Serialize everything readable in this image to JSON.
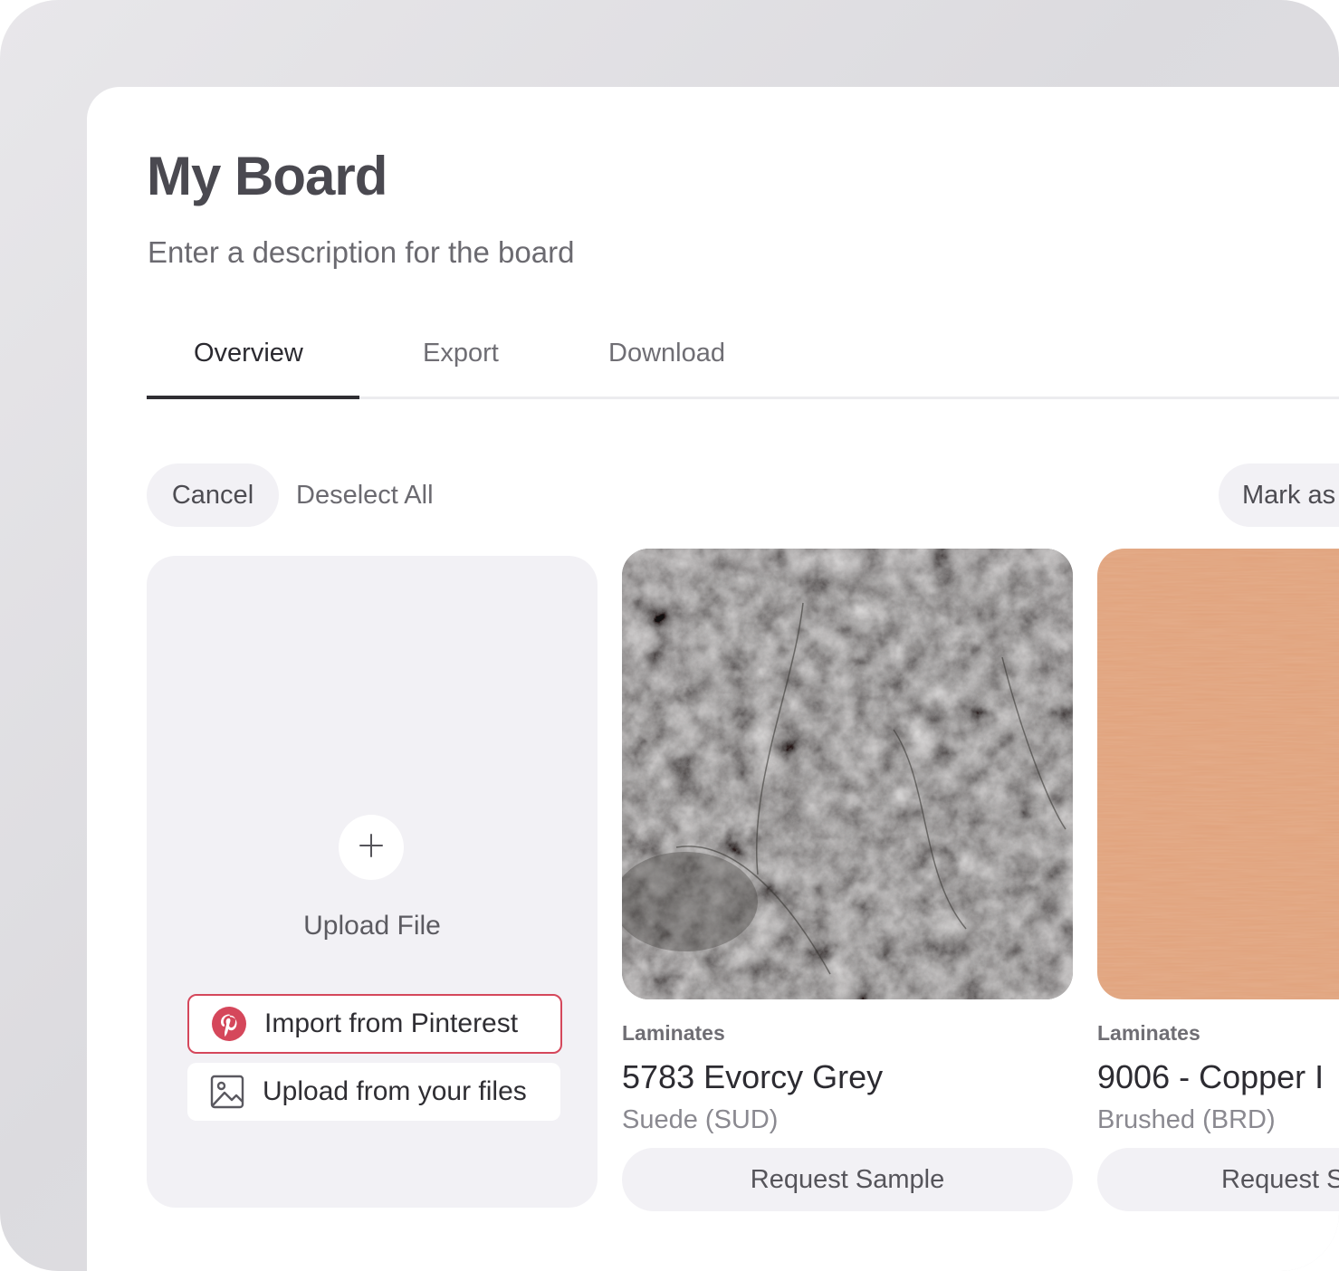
{
  "board": {
    "title": "My Board",
    "description": "Enter a description for the board"
  },
  "tabs": [
    {
      "label": "Overview",
      "active": true
    },
    {
      "label": "Export",
      "active": false
    },
    {
      "label": "Download",
      "active": false
    }
  ],
  "toolbar": {
    "cancel_label": "Cancel",
    "deselect_label": "Deselect All",
    "mark_label": "Mark as"
  },
  "upload": {
    "label": "Upload File",
    "pinterest_label": "Import from Pinterest",
    "files_label": "Upload from your files",
    "icons": [
      "plus-icon",
      "pinterest-icon",
      "image-icon"
    ]
  },
  "products": [
    {
      "category": "Laminates",
      "name": "5783 Evorcy Grey",
      "finish": "Suede (SUD)",
      "button": "Request Sample",
      "swatch_color": "#6d6866"
    },
    {
      "category": "Laminates",
      "name": "9006 - Copper I",
      "finish": "Brushed (BRD)",
      "button": "Request S",
      "swatch_color": "#e0a27c"
    }
  ],
  "colors": {
    "pinterest": "#d5475b",
    "pill_bg": "#f2f1f5",
    "title": "#4a4950"
  }
}
